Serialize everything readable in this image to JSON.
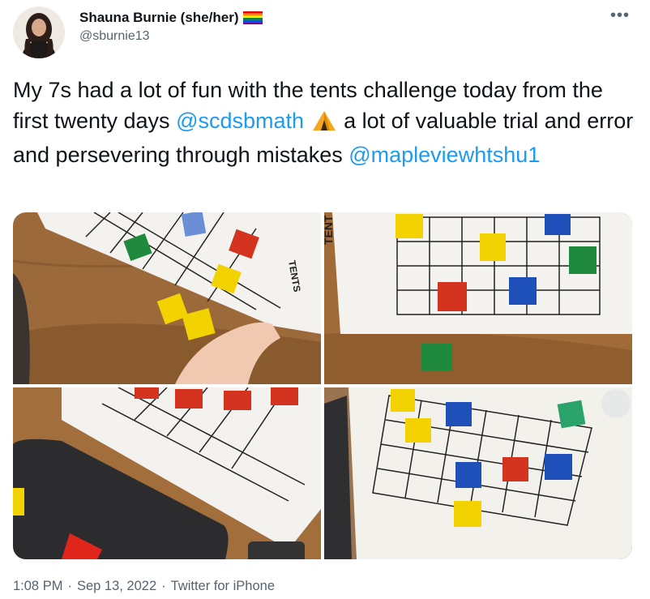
{
  "tweet": {
    "author": {
      "display_name": "Shauna Burnie (she/her)",
      "name_emoji": "rainbow-flag",
      "handle": "@sburnie13",
      "avatar_icon": "avatar-photo"
    },
    "more_icon": "more-horizontal-icon",
    "text": {
      "part1": "My 7s had a lot of fun with the tents challenge today from the first twenty days ",
      "mention1": "@scdsbmath",
      "emoji": "tent-emoji",
      "part2": " a lot of valuable trial and error and persevering through mistakes ",
      "mention2": "@mapleviewhtshu1"
    },
    "photos": [
      {
        "label": "photo-1"
      },
      {
        "label": "photo-2"
      },
      {
        "label": "photo-3"
      },
      {
        "label": "photo-4"
      }
    ],
    "meta": {
      "time": "1:08 PM",
      "sep1": "·",
      "date": "Sep 13, 2022",
      "sep2": "·",
      "source": "Twitter for iPhone"
    }
  },
  "colors": {
    "link": "#1d9bf0",
    "text": "#0f1419",
    "muted": "#536471",
    "table_wood": "#9c6a3a",
    "tile_yellow": "#f2d200",
    "tile_green": "#1f8a3e",
    "tile_red": "#d3331f",
    "tile_blue": "#1f4fb8"
  }
}
